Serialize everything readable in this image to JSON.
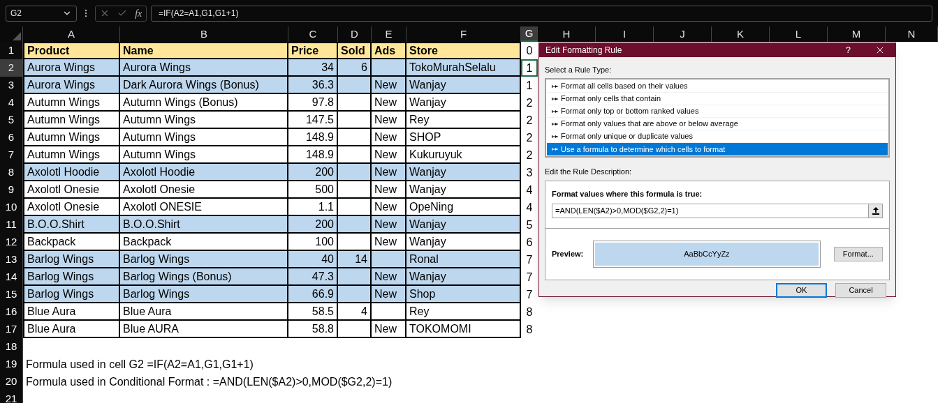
{
  "formula_bar": {
    "name_box": "G2",
    "function_label": "fx",
    "formula": "=IF(A2=A1,G1,G1+1)"
  },
  "columns": [
    {
      "label": "A",
      "selected": false
    },
    {
      "label": "B",
      "selected": false
    },
    {
      "label": "C",
      "selected": false
    },
    {
      "label": "D",
      "selected": false
    },
    {
      "label": "E",
      "selected": false
    },
    {
      "label": "F",
      "selected": false
    },
    {
      "label": "G",
      "selected": true
    },
    {
      "label": "H",
      "selected": false
    },
    {
      "label": "I",
      "selected": false
    },
    {
      "label": "J",
      "selected": false
    },
    {
      "label": "K",
      "selected": false
    },
    {
      "label": "L",
      "selected": false
    },
    {
      "label": "M",
      "selected": false
    },
    {
      "label": "N",
      "selected": false
    }
  ],
  "rows": [
    {
      "number": "1",
      "kind": "header",
      "cells": {
        "A": "Product",
        "B": "Name",
        "C": "Price",
        "D": "Sold",
        "E": "Ads",
        "F": "Store"
      },
      "g": {
        "text": "0",
        "selected": false
      }
    },
    {
      "number": "2",
      "kind": "data",
      "highlighted": true,
      "cells": {
        "A": "Aurora Wings",
        "B": "Aurora Wings",
        "C": "34",
        "D": "6",
        "F": "TokoMurahSelalu"
      },
      "g": {
        "text": "1",
        "selected": true
      }
    },
    {
      "number": "3",
      "kind": "data",
      "highlighted": true,
      "cells": {
        "A": "Aurora Wings",
        "B": "Dark Aurora Wings (Bonus)",
        "C": "36.3",
        "E": "New",
        "F": "Wanjay"
      },
      "g": {
        "text": "1",
        "selected": false
      }
    },
    {
      "number": "4",
      "kind": "data",
      "highlighted": false,
      "cells": {
        "A": "Autumn Wings",
        "B": "Autumn Wings (Bonus)",
        "C": "97.8",
        "E": "New",
        "F": "Wanjay"
      },
      "g": {
        "text": "2",
        "selected": false
      }
    },
    {
      "number": "5",
      "kind": "data",
      "highlighted": false,
      "cells": {
        "A": "Autumn Wings",
        "B": "Autumn Wings",
        "C": "147.5",
        "E": "New",
        "F": "Rey"
      },
      "g": {
        "text": "2",
        "selected": false
      }
    },
    {
      "number": "6",
      "kind": "data",
      "highlighted": false,
      "cells": {
        "A": "Autumn Wings",
        "B": "Autumn Wings",
        "C": "148.9",
        "E": "New",
        "F": "SHOP"
      },
      "g": {
        "text": "2",
        "selected": false
      }
    },
    {
      "number": "7",
      "kind": "data",
      "highlighted": false,
      "cells": {
        "A": "Autumn Wings",
        "B": "Autumn Wings",
        "C": "148.9",
        "E": "New",
        "F": "Kukuruyuk"
      },
      "g": {
        "text": "2",
        "selected": false
      }
    },
    {
      "number": "8",
      "kind": "data",
      "highlighted": true,
      "cells": {
        "A": "Axolotl Hoodie",
        "B": "Axolotl Hoodie",
        "C": "200",
        "E": "New",
        "F": "Wanjay"
      },
      "g": {
        "text": "3",
        "selected": false
      }
    },
    {
      "number": "9",
      "kind": "data",
      "highlighted": false,
      "cells": {
        "A": "Axolotl Onesie",
        "B": "Axolotl Onesie",
        "C": "500",
        "E": "New",
        "F": "Wanjay"
      },
      "g": {
        "text": "4",
        "selected": false
      }
    },
    {
      "number": "10",
      "kind": "data",
      "highlighted": false,
      "cells": {
        "A": "Axolotl Onesie",
        "B": "Axolotl ONESIE",
        "C": "1.1",
        "E": "New",
        "F": "OpeNing"
      },
      "g": {
        "text": "4",
        "selected": false
      }
    },
    {
      "number": "11",
      "kind": "data",
      "highlighted": true,
      "cells": {
        "A": "B.O.O.Shirt",
        "B": "B.O.O.Shirt",
        "C": "200",
        "E": "New",
        "F": "Wanjay"
      },
      "g": {
        "text": "5",
        "selected": false
      }
    },
    {
      "number": "12",
      "kind": "data",
      "highlighted": false,
      "cells": {
        "A": "Backpack",
        "B": "Backpack",
        "C": "100",
        "E": "New",
        "F": "Wanjay"
      },
      "g": {
        "text": "6",
        "selected": false
      }
    },
    {
      "number": "13",
      "kind": "data",
      "highlighted": true,
      "cells": {
        "A": "Barlog Wings",
        "B": "Barlog Wings",
        "C": "40",
        "D": "14",
        "F": "Ronal"
      },
      "g": {
        "text": "7",
        "selected": false
      }
    },
    {
      "number": "14",
      "kind": "data",
      "highlighted": true,
      "cells": {
        "A": "Barlog Wings",
        "B": "Barlog Wings (Bonus)",
        "C": "47.3",
        "E": "New",
        "F": "Wanjay"
      },
      "g": {
        "text": "7",
        "selected": false
      }
    },
    {
      "number": "15",
      "kind": "data",
      "highlighted": true,
      "cells": {
        "A": "Barlog Wings",
        "B": "Barlog Wings",
        "C": "66.9",
        "E": "New",
        "F": "Shop"
      },
      "g": {
        "text": "7",
        "selected": false
      }
    },
    {
      "number": "16",
      "kind": "data",
      "highlighted": false,
      "cells": {
        "A": "Blue Aura",
        "B": "Blue Aura",
        "C": "58.5",
        "D": "4",
        "F": "Rey"
      },
      "g": {
        "text": "8",
        "selected": false
      }
    },
    {
      "number": "17",
      "kind": "data",
      "highlighted": false,
      "cells": {
        "A": "Blue Aura",
        "B": "Blue AURA",
        "C": "58.8",
        "E": "New",
        "F": "TOKOMOMI"
      },
      "g": {
        "text": "8",
        "selected": false
      }
    },
    {
      "number": "18",
      "kind": "blank"
    },
    {
      "number": "19",
      "kind": "note",
      "note": "Formula used in cell G2 =IF(A2=A1,G1,G1+1)"
    },
    {
      "number": "20",
      "kind": "note",
      "note": "Formula used in Conditional Format : =AND(LEN($A2)>0,MOD($G2,2)=1)"
    },
    {
      "number": "21",
      "kind": "blank"
    }
  ],
  "dialog": {
    "title": "Edit Formatting Rule",
    "help": "?",
    "rule_type_label": "Select a Rule Type:",
    "rule_types": [
      {
        "label": "Format all cells based on their values",
        "selected": false
      },
      {
        "label": "Format only cells that contain",
        "selected": false
      },
      {
        "label": "Format only top or bottom ranked values",
        "selected": false
      },
      {
        "label": "Format only values that are above or below average",
        "selected": false
      },
      {
        "label": "Format only unique or duplicate values",
        "selected": false
      },
      {
        "label": "Use a formula to determine which cells to format",
        "selected": true
      }
    ],
    "description_label": "Edit the Rule Description:",
    "formula_label": "Format values where this formula is true:",
    "formula": "=AND(LEN($A2)>0,MOD($G2,2)=1)",
    "preview_label": "Preview:",
    "preview_text": "AaBbCcYyZz",
    "format_button": "Format...",
    "ok_button": "OK",
    "cancel_button": "Cancel"
  }
}
